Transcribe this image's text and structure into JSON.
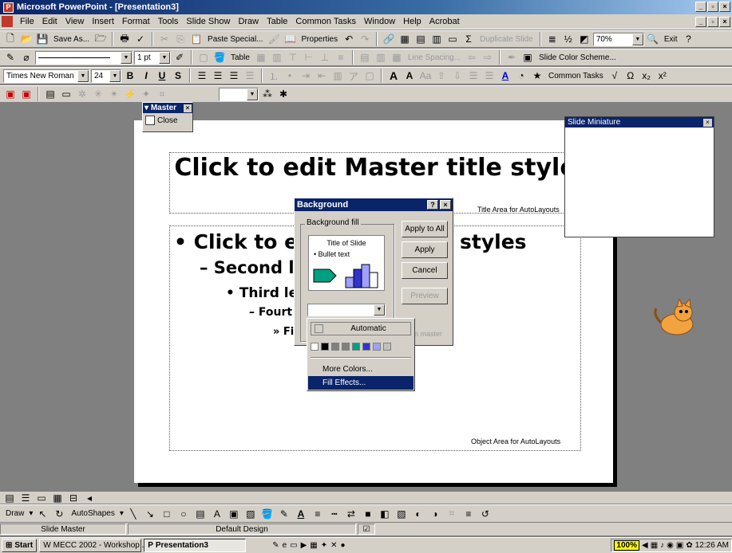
{
  "window": {
    "title": "Microsoft PowerPoint - [Presentation3]"
  },
  "menubar": {
    "items": [
      "File",
      "Edit",
      "View",
      "Insert",
      "Format",
      "Tools",
      "Slide Show",
      "Draw",
      "Table",
      "Common Tasks",
      "Window",
      "Help",
      "Acrobat"
    ]
  },
  "toolbar1": {
    "save_as": "Save As...",
    "paste_special": "Paste Special...",
    "properties": "Properties",
    "duplicate_slide": "Duplicate Slide",
    "zoom": "70%",
    "exit": "Exit"
  },
  "toolbar2": {
    "line_weight": "1 pt",
    "table": "Table",
    "line_spacing": "Line Spacing...",
    "slide_color_scheme": "Slide Color Scheme..."
  },
  "toolbar3": {
    "font_name": "Times New Roman",
    "font_size": "24",
    "common_tasks": "Common Tasks"
  },
  "master_toolbar": {
    "title": "Master",
    "close": "Close"
  },
  "slide": {
    "title_text": "Click to edit Master title style",
    "title_area_label": "Title Area for AutoLayouts",
    "object_area_label": "Object Area for AutoLayouts",
    "bullets": [
      "• Click to e",
      "styles",
      "– Second le",
      "• Third le",
      "– Fourt",
      "» Fi"
    ]
  },
  "slide_miniature": {
    "title": "Slide Miniature"
  },
  "background_dialog": {
    "title": "Background",
    "fill_group": "Background fill",
    "preview_title": "Title of Slide",
    "preview_bullet": "• Bullet text",
    "apply_to_all": "Apply to All",
    "apply": "Apply",
    "cancel": "Cancel",
    "preview": "Preview",
    "omit_master": "n master"
  },
  "color_menu": {
    "automatic": "Automatic",
    "swatches": [
      "#ffffff",
      "#000000",
      "#808080",
      "#808080",
      "#00a080",
      "#3333cc",
      "#a0a0ff",
      "#c0c0c0"
    ],
    "more_colors": "More Colors...",
    "fill_effects": "Fill Effects..."
  },
  "drawbar": {
    "draw": "Draw",
    "autoshapes": "AutoShapes"
  },
  "statusbar": {
    "view": "Slide Master",
    "design": "Default Design"
  },
  "taskbar": {
    "start": "Start",
    "task1": "MECC 2002 - Workshop ...",
    "task2": "Presentation3",
    "zoom_badge": "100%",
    "clock": "12:26 AM"
  },
  "colors": {
    "title_blue": "#0a246a",
    "face": "#d4d0c8",
    "workspace": "#808080"
  }
}
